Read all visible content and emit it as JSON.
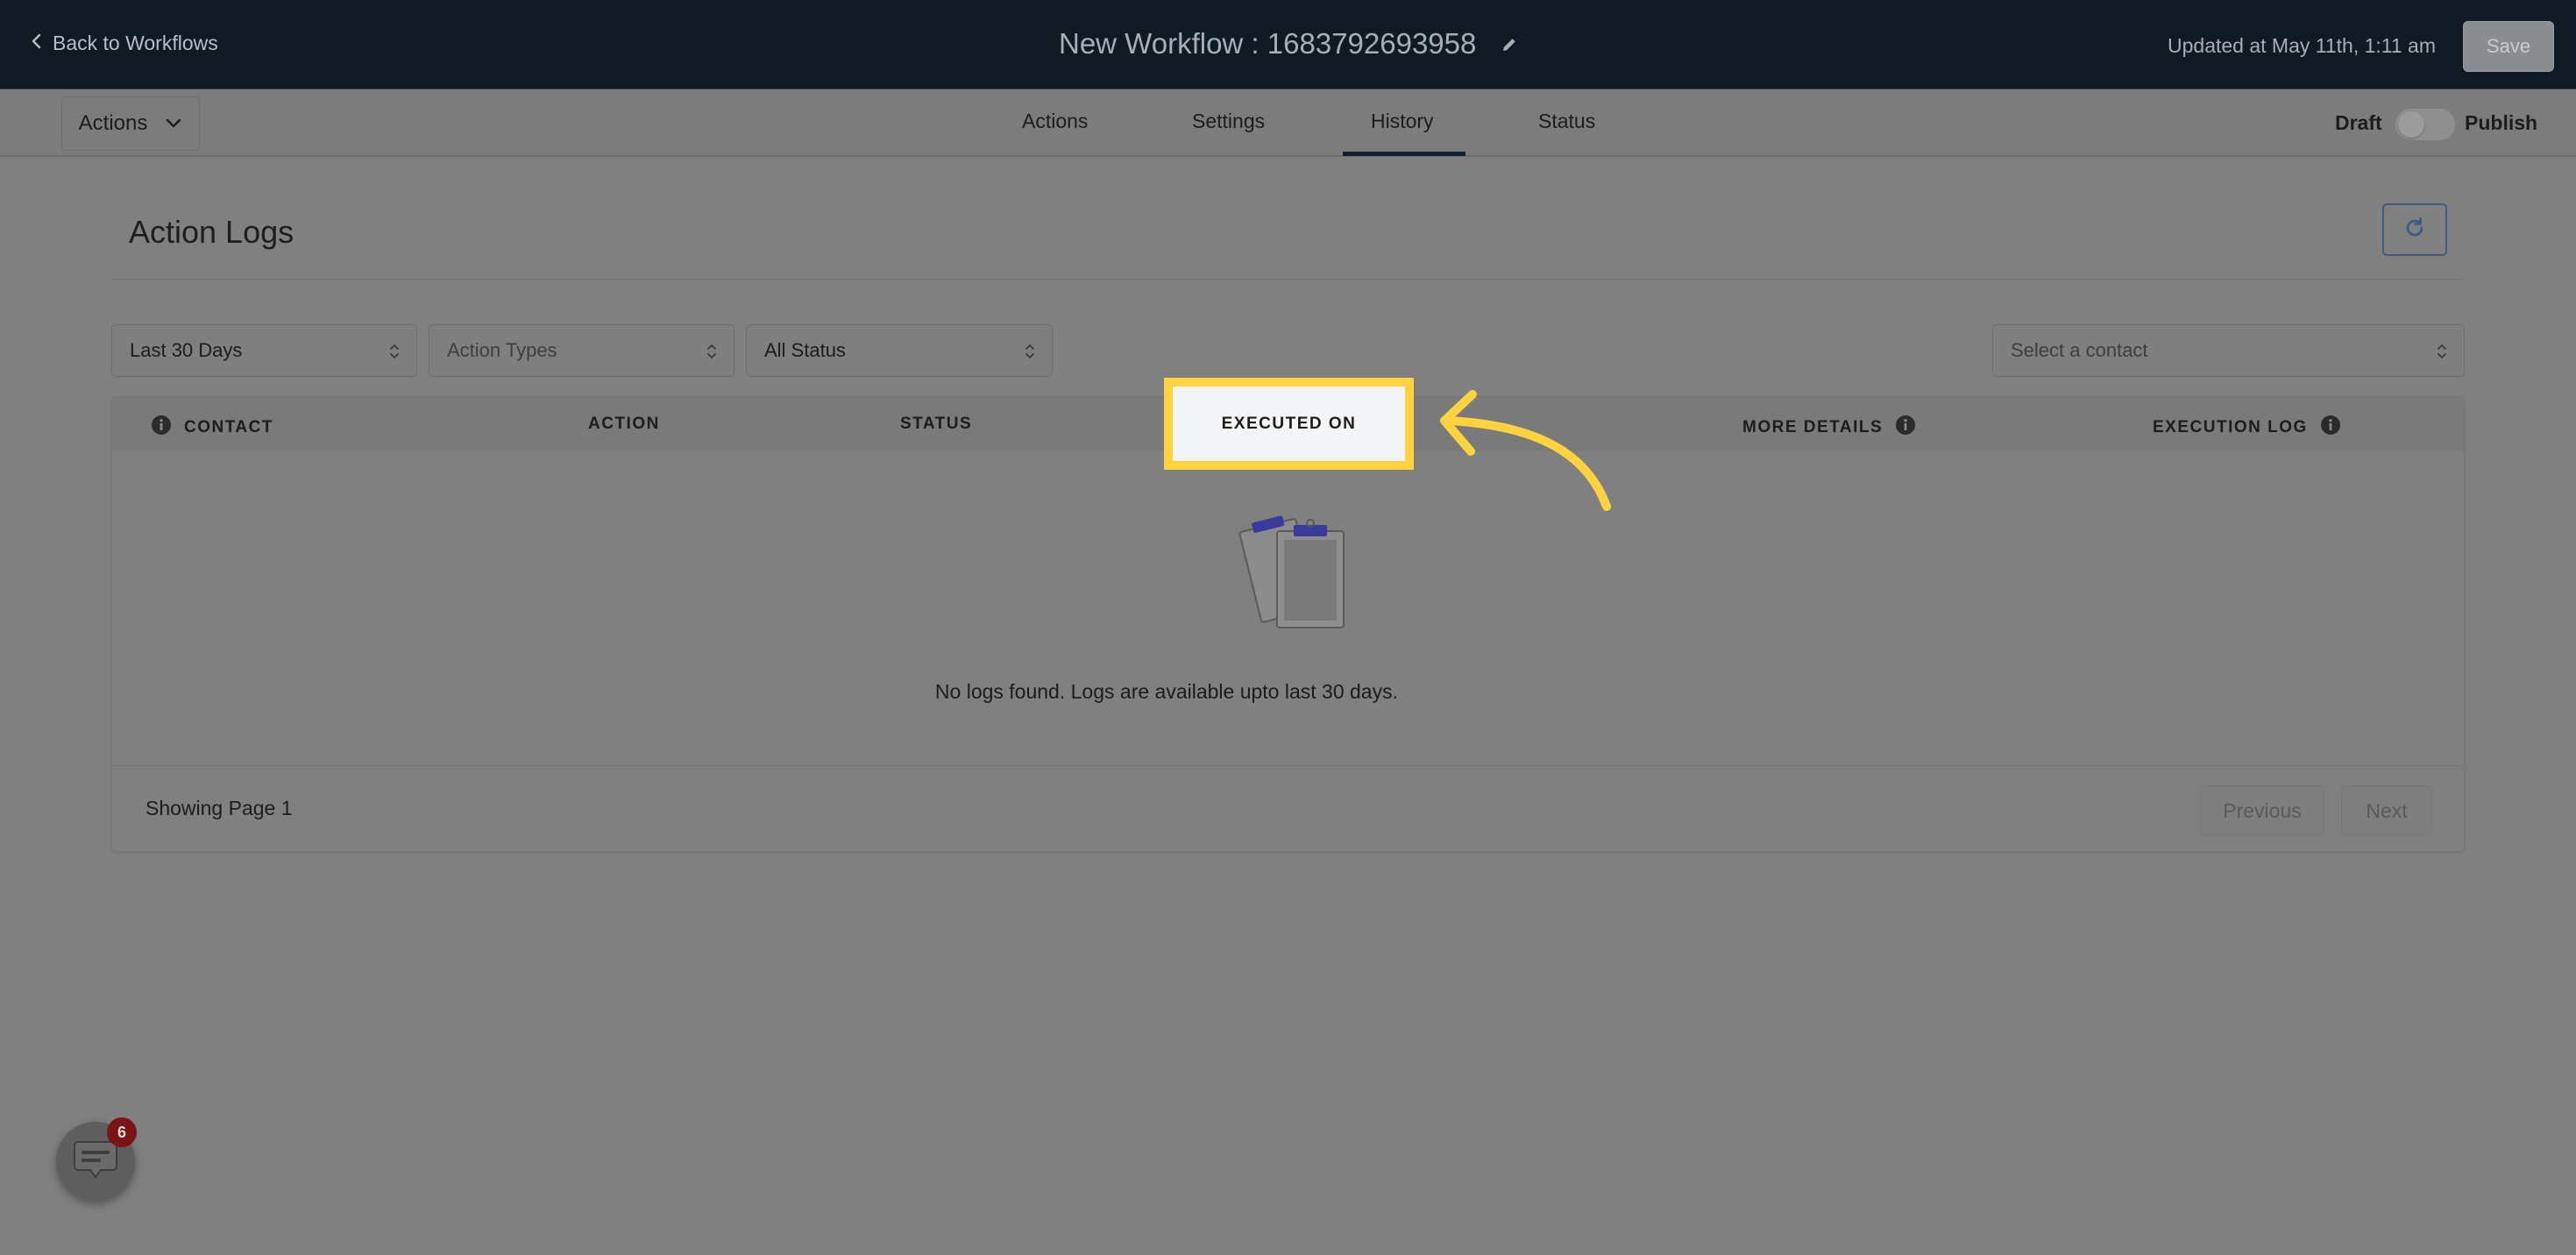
{
  "header": {
    "back_label": "Back to Workflows",
    "workflow_title": "New Workflow : 1683792693958",
    "updated_at": "Updated at May 11th, 1:11 am",
    "save_label": "Save"
  },
  "navbar": {
    "actions_dropdown_label": "Actions",
    "tabs": [
      {
        "label": "Actions",
        "active": false
      },
      {
        "label": "Settings",
        "active": false
      },
      {
        "label": "History",
        "active": true
      },
      {
        "label": "Status",
        "active": false
      }
    ],
    "draft_label": "Draft",
    "publish_label": "Publish",
    "publish_toggle_on": false
  },
  "page": {
    "title": "Action Logs",
    "refresh_icon": "refresh-icon"
  },
  "filters": {
    "date_range": "Last 30 Days",
    "action_types_placeholder": "Action Types",
    "status": "All Status",
    "contact_placeholder": "Select a contact"
  },
  "table": {
    "columns": {
      "contact": "CONTACT",
      "action": "ACTION",
      "status": "STATUS",
      "executed_on": "EXECUTED ON",
      "more_details": "MORE DETAILS",
      "execution_log": "EXECUTION LOG"
    },
    "empty_message": "No logs found. Logs are available upto last 30 days.",
    "showing_text": "Showing Page 1",
    "previous_label": "Previous",
    "next_label": "Next"
  },
  "chat": {
    "badge_count": "6"
  },
  "colors": {
    "header_bg": "#0f1a25",
    "highlight": "#ffd23f",
    "overlay_bg": "#808080"
  }
}
